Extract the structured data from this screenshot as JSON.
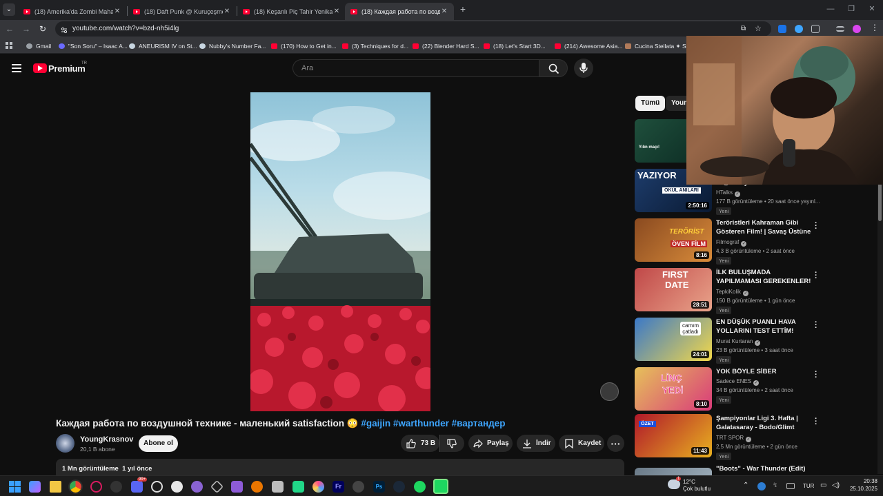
{
  "browser": {
    "tabs": [
      {
        "label": "(18) Amerika'da Zombi Mahalle",
        "active": false
      },
      {
        "label": "(18) Daft Punk @ Kuruçeşme A",
        "active": false
      },
      {
        "label": "(18) Keşanlı Piç Tahir Yenikarpu",
        "active": false
      },
      {
        "label": "(18) Каждая работа по воздуш",
        "active": true
      }
    ],
    "url": "youtube.com/watch?v=bzd-nh5i4lg",
    "bookmarks": [
      {
        "label": "Gmail",
        "icon": "gmail-icon",
        "color": "#9aa0a6"
      },
      {
        "label": "\"Son Soru\" – Isaac A...",
        "icon": "globe-icon",
        "color": "#6b6bff"
      },
      {
        "label": "ANEURISM IV on St...",
        "icon": "steam-icon",
        "color": "#c7d5e0"
      },
      {
        "label": "Nubby's Number Fa...",
        "icon": "steam-icon",
        "color": "#c7d5e0"
      },
      {
        "label": "(170) How to Get in...",
        "icon": "youtube-icon",
        "color": "#ff0033"
      },
      {
        "label": "(3) Techniques for d...",
        "icon": "youtube-icon",
        "color": "#ff0033"
      },
      {
        "label": "(22) Blender Hard S...",
        "icon": "youtube-icon",
        "color": "#ff0033"
      },
      {
        "label": "(18) Let's Start 3D...",
        "icon": "youtube-icon",
        "color": "#ff0033"
      },
      {
        "label": "(214) Awesome Asia...",
        "icon": "youtube-icon",
        "color": "#ff0033"
      },
      {
        "label": "Cucina Stellata ✦ St...",
        "icon": "bookmark-page-icon",
        "color": "#b07a5a"
      }
    ]
  },
  "header": {
    "logo_text": "Premium",
    "logo_sup": "TR",
    "search_placeholder": "Ara"
  },
  "video": {
    "title": "Каждая работа по воздушной технике - маленький satisfaction 😳",
    "hashtags": "#gaijin #warthunder #вартандер",
    "channel": "YoungKrasnov",
    "subscribers": "20,1 B abone",
    "subscribe_label": "Abone ol",
    "likes": "73 B",
    "share_label": "Paylaş",
    "download_label": "İndir",
    "save_label": "Kaydet",
    "views": "1 Mn görüntüleme",
    "age": "1 yıl önce"
  },
  "sidebar": {
    "chips": [
      "Tümü",
      "Youn"
    ],
    "items": [
      {
        "title": "",
        "channel": "",
        "meta": "",
        "badge": "",
        "duration": "",
        "thumb_colors": [
          "#1f4f3c",
          "#0b2a22"
        ]
      },
      {
        "title": "w/@KorayKoc-kr",
        "channel": "HTalks",
        "meta": "177 B görüntüleme • 20 saat önce yayınl...",
        "badge": "Yeni",
        "duration": "2:50:16",
        "thumb_colors": [
          "#1d3c6b",
          "#0a1a33"
        ]
      },
      {
        "title": "Teröristleri Kahraman Gibi Gösteren Film! | Savaş Üstüne ...",
        "channel": "Filmograf",
        "meta": "4,3 B görüntüleme • 2 saat önce",
        "badge": "Yeni",
        "duration": "8:16",
        "thumb_colors": [
          "#8a4a20",
          "#d88b3a"
        ]
      },
      {
        "title": "İLK BULUŞMADA YAPILMAMASI GEREKENLER!",
        "channel": "TepkiKolik",
        "meta": "150 B görüntüleme • 1 gün önce",
        "badge": "Yeni",
        "duration": "28:51",
        "thumb_colors": [
          "#c04848",
          "#e9a38a"
        ]
      },
      {
        "title": "EN DÜŞÜK PUANLI HAVA YOLLARINI TEST ETTİM!",
        "channel": "Murat Kurtaran",
        "meta": "23 B görüntüleme • 3 saat önce",
        "badge": "Yeni",
        "duration": "24:01",
        "thumb_colors": [
          "#3a78c8",
          "#f2d84a"
        ]
      },
      {
        "title": "YOK BÖYLE SİBER ZORBALIK!",
        "channel": "Sadece ENES",
        "meta": "34 B görüntüleme • 2 saat önce",
        "badge": "Yeni",
        "duration": "8:10",
        "thumb_colors": [
          "#e6c15a",
          "#d93b7a"
        ]
      },
      {
        "title": "Şampiyonlar Ligi 3. Hafta | Galatasaray - Bodo/Glimt (Özet)",
        "channel": "TRT SPOR",
        "meta": "2,5 Mn görüntüleme • 2 gün önce",
        "badge": "Yeni",
        "duration": "11:43",
        "thumb_colors": [
          "#b0182a",
          "#e8b020"
        ]
      },
      {
        "title": "\"Boots\" - War Thunder (Edit)",
        "channel": "",
        "meta": "",
        "badge": "",
        "duration": "",
        "thumb_colors": [
          "#6a7a88",
          "#9aaab6"
        ]
      }
    ],
    "thumb_texts": {
      "t0_a": "Yılın maçı!",
      "t1_a": "YAZIYOR",
      "t1_b": "OKUL ANILARI",
      "t2_a": "TERÖRİST",
      "t2_b": "ÖVEN FİLM",
      "t3_a": "FIRST",
      "t3_b": "DATE",
      "t4_a": "camım",
      "t4_b": "çatladı",
      "t5_a": "LİNÇ",
      "t5_b": "YEDİ",
      "t6_a": "ÖZET"
    }
  },
  "taskbar": {
    "weather_temp": "12°C",
    "weather_desc": "Çok bulutlu",
    "weather_badge": "1",
    "language": "TUR",
    "time": "20:38",
    "date": "25.10.2025",
    "discord_badge": "99+"
  }
}
